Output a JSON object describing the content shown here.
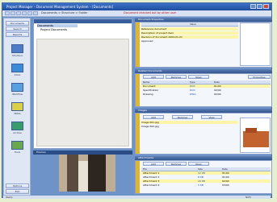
{
  "window": {
    "title": "Project Manager – Document Management System – [Documents]"
  },
  "toolbar": {
    "path_text": "Documents > Structure > Folder",
    "alert_text": "Document checked out by other user"
  },
  "sidebar": {
    "top_buttons": [
      "Documents",
      "Search",
      "Reports"
    ],
    "items": [
      {
        "label": "Structure",
        "icon": "folder-icon",
        "color": "#4e7cc6"
      },
      {
        "label": "Inbox",
        "icon": "mail-icon",
        "color": "#3d8ad8"
      },
      {
        "label": "Workflow",
        "icon": "workflow-icon",
        "color": "#58a0e0"
      },
      {
        "label": "Notes",
        "icon": "note-icon",
        "color": "#d9d048"
      },
      {
        "label": "Archive",
        "icon": "archive-icon",
        "color": "#3a9c6a"
      },
      {
        "label": "Tools",
        "icon": "tools-icon",
        "color": "#6aa84f"
      }
    ],
    "bottom_buttons": [
      "Options",
      "Exit"
    ]
  },
  "tree": {
    "items": [
      "Documents",
      "Project Documents"
    ]
  },
  "preview": {
    "title": "Preview"
  },
  "panel1": {
    "title": "Document Properties",
    "header": "Value",
    "rows": [
      "Reference document",
      "Description of project item",
      "Revision of document 2004-01-21",
      "Approved"
    ]
  },
  "panel2": {
    "title": "Related Documents",
    "buttons": [
      "Add",
      "Remove",
      "Open",
      "Properties"
    ],
    "headers": [
      "Name",
      "Type",
      "Date"
    ],
    "rows": [
      {
        "name": "Document",
        "type": "DOC",
        "date": "01/04"
      },
      {
        "name": "Specification",
        "type": "DOC",
        "date": "02/04"
      },
      {
        "name": "Drawing",
        "type": "DWG",
        "date": "02/04"
      }
    ]
  },
  "panel3": {
    "title": "Images",
    "buttons": [
      "Add",
      "Remove",
      "View"
    ],
    "rows": [
      "Image 001.jpg",
      "Image 002.jpg"
    ]
  },
  "panel4": {
    "title": "Attachments",
    "buttons": [
      "Add",
      "Remove",
      "Open"
    ],
    "headers": [
      "File",
      "Size",
      "Date"
    ],
    "rows": [
      {
        "name": "Attachment 1",
        "size": "12 KB",
        "date": "01/04"
      },
      {
        "name": "Attachment 2",
        "size": "8 KB",
        "date": "01/04"
      },
      {
        "name": "Attachment 3",
        "size": "20 KB",
        "date": "02/04"
      },
      {
        "name": "Attachment 4",
        "size": "5 KB",
        "date": "03/04"
      }
    ]
  },
  "status": {
    "left": "Ready",
    "right": "NUM"
  }
}
